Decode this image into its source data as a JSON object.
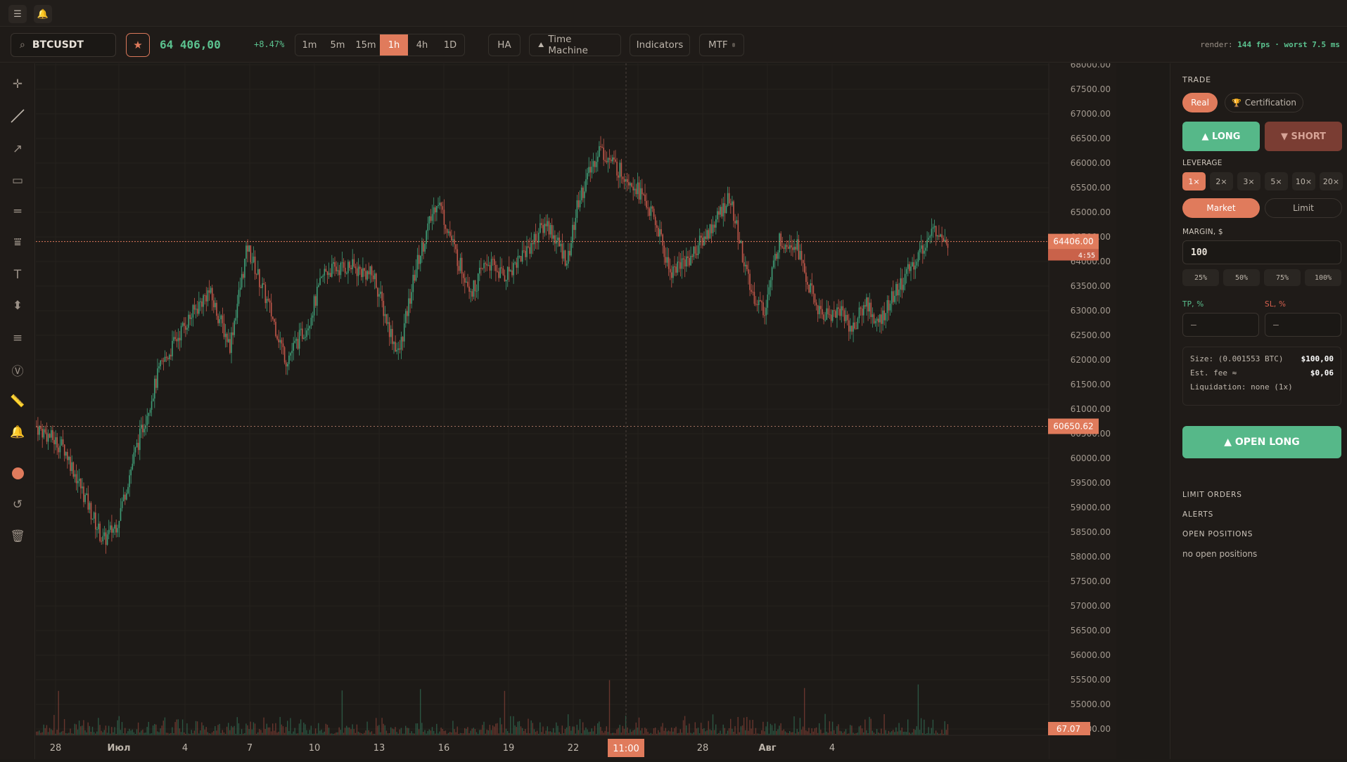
{
  "topbar": {
    "menu_icon": "menu-icon",
    "bell_icon": "bell-icon"
  },
  "toolbar": {
    "symbol": "BTCUSDT",
    "price": "64 406,00",
    "change": "+8.47%",
    "timeframes": [
      "1m",
      "5m",
      "15m",
      "1h",
      "4h",
      "1D"
    ],
    "active_timeframe": "1h",
    "ha": "HA",
    "time_machine": "Time Machine",
    "indicators": "Indicators",
    "mtf": "MTF",
    "render_label": "render:",
    "render_fps": "144 fps",
    "render_sep": "·",
    "render_worst": "worst 7.5 ms"
  },
  "chart": {
    "price_labels": [
      "68000.00",
      "67500.00",
      "67000.00",
      "66500.00",
      "66000.00",
      "65500.00",
      "65000.00",
      "64500.00",
      "64000.00",
      "63500.00",
      "63000.00",
      "62500.00",
      "62000.00",
      "61500.00",
      "61000.00",
      "60500.00",
      "60000.00",
      "59500.00",
      "59000.00",
      "58500.00",
      "58000.00",
      "57500.00",
      "57000.00",
      "56500.00",
      "56000.00",
      "55500.00",
      "55000.00",
      "54500.00"
    ],
    "date_labels": [
      "28",
      "Июл",
      "4",
      "7",
      "10",
      "13",
      "16",
      "19",
      "22",
      "",
      "28",
      "Авг",
      "4"
    ],
    "current_price": "64406.00",
    "countdown": "4:55",
    "hline_price": "60650.62",
    "volume_badge": "67.07",
    "crosshair_time": "11:00",
    "colors": {
      "up": "#3f9e78",
      "down": "#c2574a",
      "accent": "#e07b5c"
    }
  },
  "trade": {
    "title": "TRADE",
    "mode_real": "Real",
    "mode_cert": "Certification",
    "long": "▲ LONG",
    "short": "▼ SHORT",
    "leverage_title": "LEVERAGE",
    "leverage_options": [
      "1×",
      "2×",
      "3×",
      "5×",
      "10×",
      "20×"
    ],
    "order_market": "Market",
    "order_limit": "Limit",
    "margin_title": "MARGIN, $",
    "margin_value": "100",
    "pct_options": [
      "25%",
      "50%",
      "75%",
      "100%"
    ],
    "tp_title": "TP, %",
    "sl_title": "SL, %",
    "tp_value": "—",
    "sl_value": "—",
    "size_label": "Size: (0.001553 BTC)",
    "size_value": "$100,00",
    "fee_label": "Est. fee ≈",
    "fee_value": "$0,06",
    "liq_label": "Liquidation: none (1x)",
    "open_button": "▲ OPEN LONG",
    "limit_orders": "LIMIT ORDERS",
    "alerts": "ALERTS",
    "open_positions": "OPEN POSITIONS",
    "no_positions": "no open positions"
  }
}
